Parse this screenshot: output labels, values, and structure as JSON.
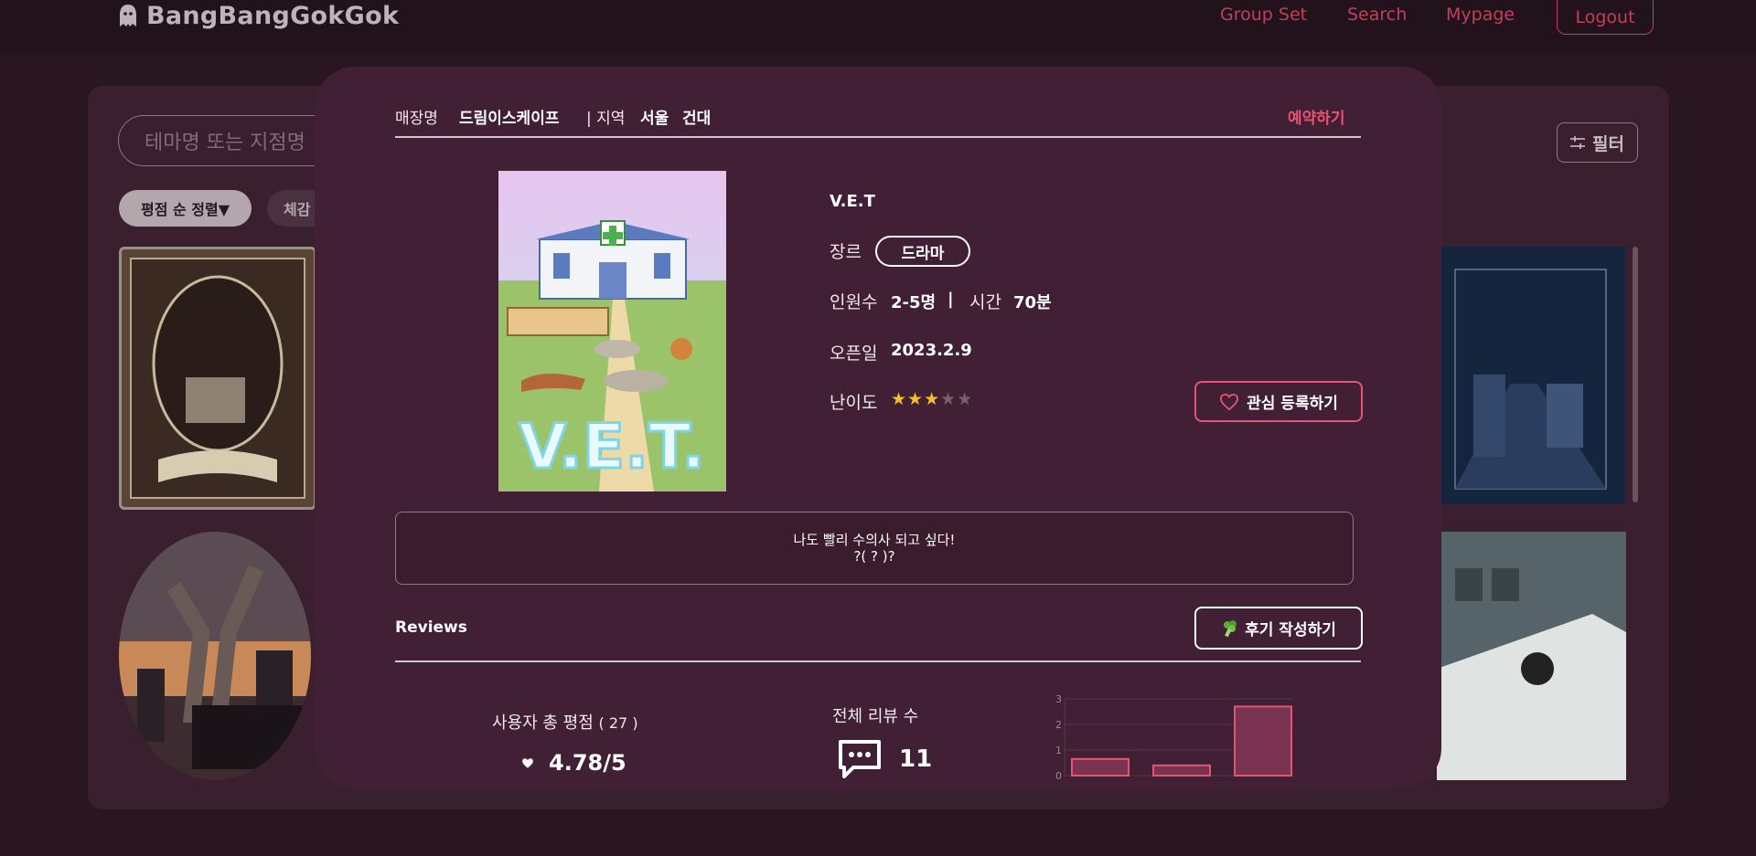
{
  "header": {
    "logo_text": "BangBangGokGok",
    "nav": [
      "Group Set",
      "Search",
      "Mypage"
    ],
    "logout_label": "Logout"
  },
  "page": {
    "search_placeholder": "테마명 또는 지점명",
    "sort_label": "평점 순 정렬▼",
    "chip2_label": "체감",
    "filter_label": "필터"
  },
  "modal": {
    "store_label": "매장명",
    "store_name": "드림이스케이프",
    "region_sep": "| 지역",
    "region_city": "서울",
    "region_area": "건대",
    "reserve_label": "예약하기",
    "theme_title": "V.E.T",
    "genre_label": "장르",
    "genre_value": "드라마",
    "people_label": "인원수",
    "people_value": "2-5명",
    "divider": "|",
    "time_label": "시간",
    "time_value": "70분",
    "open_label": "오픈일",
    "open_value": "2023.2.9",
    "difficulty_label": "난이도",
    "difficulty": 3,
    "difficulty_max": 5,
    "favorite_label": "관심 등록하기",
    "description_line1": "나도 빨리 수의사 되고 싶다!",
    "description_line2": "?( ? )?",
    "reviews_title": "Reviews",
    "write_review_label": "후기 작성하기",
    "avg_label": "사용자 총 평점",
    "avg_count": "( 27 )",
    "avg_value": "4.78/5",
    "total_reviews_label": "전체 리뷰 수",
    "total_reviews_value": "11"
  },
  "colors": {
    "accent": "#e4556f",
    "nav": "#c0405e",
    "modal_bg": "#411f34",
    "star": "#f4c02a"
  },
  "chart_data": {
    "type": "bar",
    "ylim": [
      0,
      3
    ],
    "yticks": [
      "0",
      "1",
      "2",
      "3"
    ],
    "values": [
      0.65,
      0.4,
      2.7
    ]
  }
}
